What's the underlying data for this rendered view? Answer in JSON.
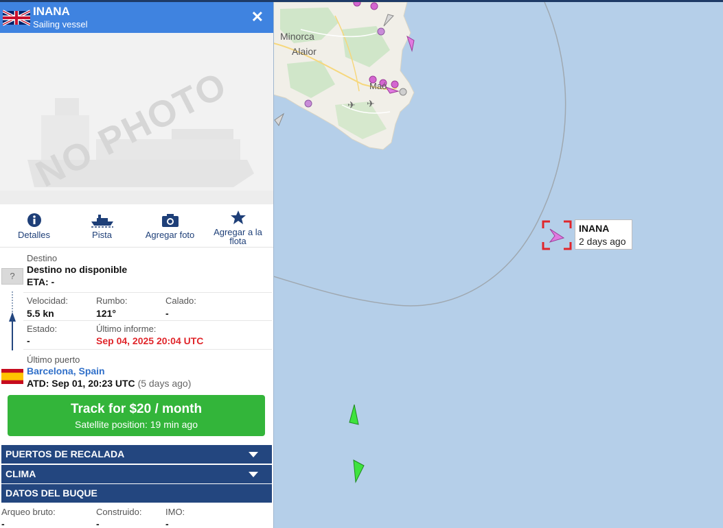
{
  "vessel": {
    "name": "INANA",
    "type": "Sailing vessel",
    "photo_placeholder": "NO PHOTO"
  },
  "actions": [
    {
      "label": "Detalles",
      "icon": "info-icon"
    },
    {
      "label": "Pista",
      "icon": "ship-track-icon"
    },
    {
      "label": "Agregar foto",
      "icon": "camera-icon"
    },
    {
      "label": "Agregar a la flota",
      "icon": "star-icon"
    }
  ],
  "destination": {
    "label": "Destino",
    "value": "Destino no disponible",
    "eta": "ETA: -",
    "unknown_flag": "?"
  },
  "stats": {
    "speed_label": "Velocidad:",
    "speed_value": "5.5 kn",
    "course_label": "Rumbo:",
    "course_value": "121°",
    "draught_label": "Calado:",
    "draught_value": "-",
    "status_label": "Estado:",
    "status_value": "-",
    "report_label": "Último informe:",
    "report_value": "Sep 04, 2025 20:04 UTC"
  },
  "last_port": {
    "label": "Último puerto",
    "name": "Barcelona, Spain",
    "atd": "ATD: Sep 01, 20:23 UTC",
    "ago": "(5 days ago)"
  },
  "track_button": {
    "title": "Track for $20 / month",
    "subtitle": "Satellite position: 19 min ago"
  },
  "sections": {
    "ports": "PUERTOS DE RECALADA",
    "weather": "CLIMA",
    "ship_data": "DATOS DEL BUQUE"
  },
  "ship_data": {
    "gt_label": "Arqueo bruto:",
    "gt_value": "-",
    "built_label": "Construido:",
    "built_value": "-",
    "imo_label": "IMO:",
    "imo_value": "-"
  },
  "map": {
    "place_minorca": "Minorca",
    "place_alaior": "Alaior",
    "place_mao": "Maó",
    "vessel_label": "INANA",
    "vessel_time": "2 days ago"
  },
  "colors": {
    "header_blue": "#3f83e0",
    "section_navy": "#23467f",
    "track_green": "#33b53a",
    "alert_red": "#e0262b",
    "link_blue": "#2f6fc9",
    "sea": "#b5cfe9",
    "land": "#f1efe8"
  }
}
